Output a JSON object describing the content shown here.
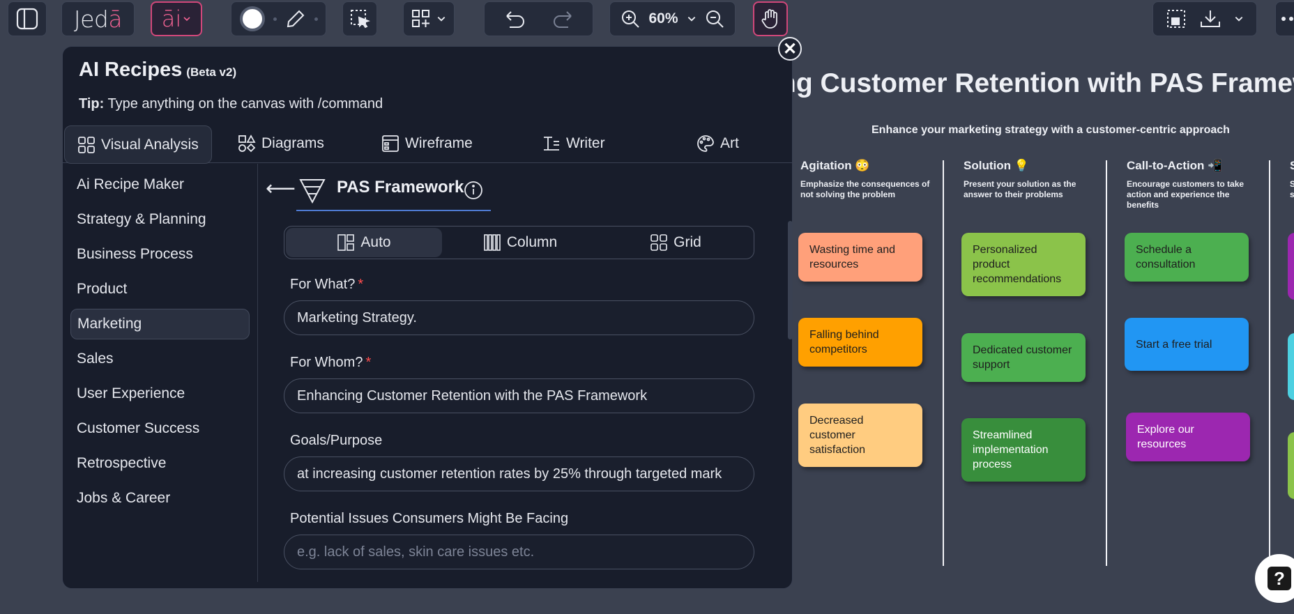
{
  "toolbar": {
    "logo": "Jed",
    "logo_accent": "ā",
    "ai_label": "āi",
    "zoom": "60%"
  },
  "canvas": {
    "title": "ng Customer Retention with PAS Framew",
    "subtitle": "Enhance your marketing strategy with a customer-centric approach",
    "columns": [
      {
        "heading": "Agitation 😳",
        "description": "Emphasize the consequences of not solving the problem"
      },
      {
        "heading": "Solution 💡",
        "description": "Present your solution as the answer to their problems"
      },
      {
        "heading": "Call-to-Action 📲",
        "description": "Encourage customers to take action and experience the benefits"
      },
      {
        "heading": "S",
        "description": "S s"
      }
    ],
    "stickies": [
      {
        "text": "Wasting time and resources",
        "color": "#ffa07a"
      },
      {
        "text": "Falling behind competitors",
        "color": "#ffa000"
      },
      {
        "text": "Decreased customer satisfaction",
        "color": "#ffcc80"
      },
      {
        "text": "Personalized product recommendations",
        "color": "#8bc34a"
      },
      {
        "text": "Dedicated customer support",
        "color": "#4caf50"
      },
      {
        "text": "Streamlined implementation process",
        "color": "#388e3c"
      },
      {
        "text": "Schedule a consultation",
        "color": "#4caf50"
      },
      {
        "text": "Start a free trial",
        "color": "#2196f3"
      },
      {
        "text": "Explore our resources",
        "color": "#9c27b0"
      }
    ]
  },
  "panel": {
    "title": "AI Recipes",
    "beta": "(Beta v2)",
    "tip_label": "Tip:",
    "tip_text": "Type anything on the canvas with /command",
    "close": "✕",
    "tabs": [
      "Visual Analysis",
      "Diagrams",
      "Wireframe",
      "Writer",
      "Art"
    ],
    "sidebar": [
      "Ai Recipe Maker",
      "Strategy & Planning",
      "Business Process",
      "Product",
      "Marketing",
      "Sales",
      "User Experience",
      "Customer Success",
      "Retrospective",
      "Jobs & Career"
    ],
    "recipe": {
      "back": "⟵",
      "title": "PAS Framework",
      "layouts": [
        "Auto",
        "Column",
        "Grid"
      ],
      "fields": [
        {
          "label": "For What?",
          "required": "*",
          "value": "Marketing Strategy."
        },
        {
          "label": "For Whom?",
          "required": "*",
          "value": "Enhancing Customer Retention with the PAS Framework"
        },
        {
          "label": "Goals/Purpose",
          "value": "at increasing customer retention rates by 25% through targeted mark"
        },
        {
          "label": "Potential Issues Consumers Might Be Facing",
          "placeholder": "e.g. lack of sales, skin care issues etc."
        }
      ]
    }
  },
  "help": "?"
}
